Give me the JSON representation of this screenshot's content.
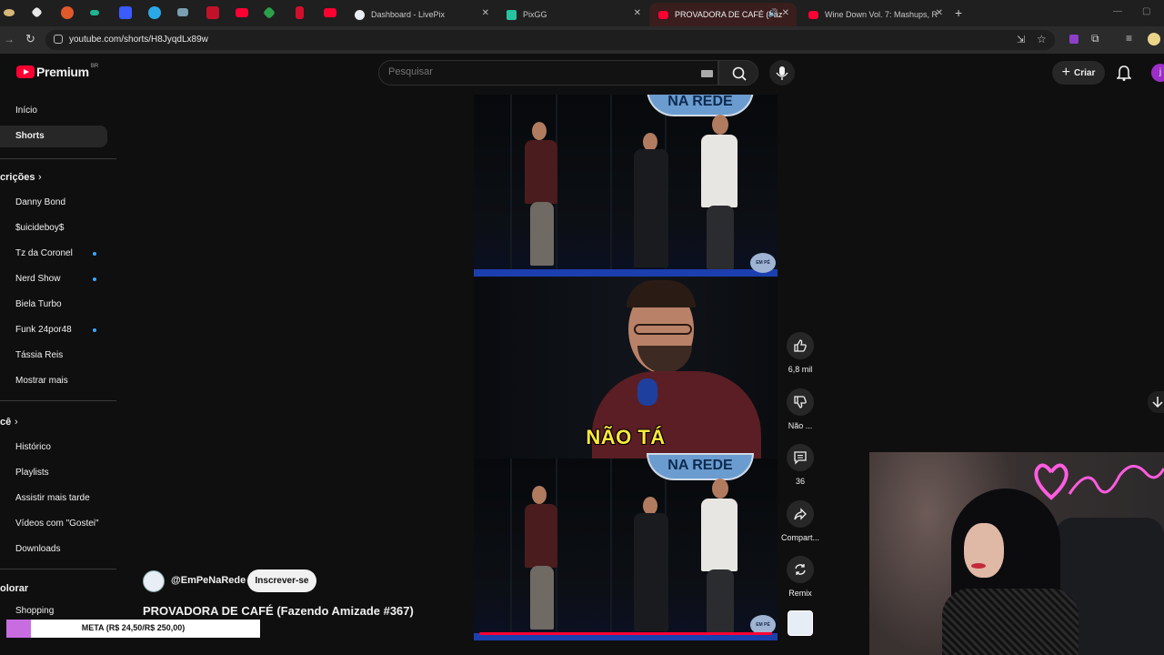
{
  "browser": {
    "tabs": [
      {
        "title": "Dashboard - LivePix",
        "active": false
      },
      {
        "title": "PixGG",
        "active": false
      },
      {
        "title": "PROVADORA DE CAFÉ (Faz",
        "active": true
      },
      {
        "title": "Wine Down Vol. 7: Mashups, R",
        "active": false
      }
    ],
    "url": "youtube.com/shorts/H8JyqdLx89w",
    "new_tab_symbol": "+"
  },
  "header": {
    "logo_text": "Premium",
    "logo_region": "BR",
    "search_placeholder": "Pesquisar",
    "create_label": "Criar",
    "avatar_letter": "j"
  },
  "sidebar": {
    "top": [
      {
        "label": "Início"
      },
      {
        "label": "Shorts",
        "active": true
      }
    ],
    "subs_heading": "crições",
    "subscriptions": [
      {
        "label": "Danny Bond",
        "new": false
      },
      {
        "label": "$uicideboy$",
        "new": false
      },
      {
        "label": "Tz da Coronel",
        "new": true
      },
      {
        "label": "Nerd Show",
        "new": true
      },
      {
        "label": "Biela Turbo",
        "new": false
      },
      {
        "label": "Funk 24por48",
        "new": true
      },
      {
        "label": "Tássia Reis",
        "new": false
      },
      {
        "label": "Mostrar mais",
        "new": false
      }
    ],
    "you_heading": "cê",
    "you_items": [
      {
        "label": "Histórico"
      },
      {
        "label": "Playlists"
      },
      {
        "label": "Assistir mais tarde"
      },
      {
        "label": "Vídeos com \"Gostei\""
      },
      {
        "label": "Downloads"
      }
    ],
    "explore_heading": "olorar",
    "explore_items": [
      {
        "label": "Shopping"
      }
    ]
  },
  "short": {
    "banner_text": "NA REDE",
    "caption": "NÃO TÁ",
    "channel": "@EmPeNaRede",
    "subscribe_label": "Inscrever-se",
    "title": "PROVADORA DE CAFÉ (Fazendo Amizade #367)",
    "progress": 1.0
  },
  "actions": {
    "like_count": "6,8 mil",
    "dislike_label": "Não ...",
    "comment_count": "36",
    "share_label": "Compart...",
    "remix_label": "Remix"
  },
  "overlay": {
    "goal_text": "META (R$ 24,50/R$ 250,00)",
    "goal_progress": 0.098
  },
  "colors": {
    "accent": "#ff0033",
    "background": "#0f0f0f",
    "caption": "#ffe93b",
    "goal_fill": "#c86de0",
    "new_dot": "#3ea6ff"
  }
}
